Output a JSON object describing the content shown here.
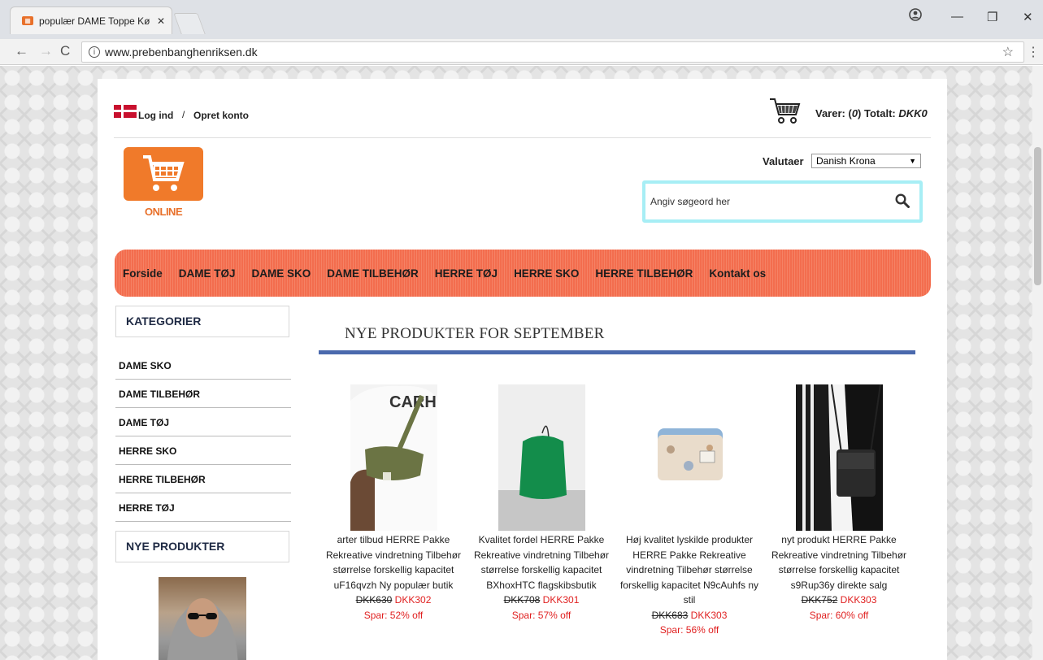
{
  "browser": {
    "tab_title": "populær DAME Toppe Kø",
    "url": "www.prebenbanghenriksen.dk"
  },
  "header": {
    "login": "Log ind",
    "separator": "/",
    "register": "Opret konto",
    "cart_prefix": "Varer: (",
    "cart_count": "0",
    "cart_mid": ") Totalt: ",
    "cart_total": "DKK0",
    "currency_label": "Valutaer",
    "currency_value": "Danish Krona",
    "search_placeholder": "Angiv søgeord her",
    "logo_text": "ONLINE"
  },
  "nav": [
    "Forside",
    "DAME TØJ",
    "DAME SKO",
    "DAME TILBEHØR",
    "HERRE TØJ",
    "HERRE SKO",
    "HERRE TILBEHØR",
    "Kontakt os"
  ],
  "sidebar": {
    "categories_title": "KATEGORIER",
    "categories": [
      "DAME SKO",
      "DAME TILBEHØR",
      "DAME TØJ",
      "HERRE SKO",
      "HERRE TILBEHØR",
      "HERRE TØJ"
    ],
    "new_products_title": "NYE PRODUKTER"
  },
  "main": {
    "title": "NYE PRODUKTER FOR SEPTEMBER",
    "products": [
      {
        "lines": [
          "arter tilbud HERRE Pakke",
          "Rekreative vindretning Tilbehør",
          "størrelse forskellig kapacitet",
          "uF16qvzh Ny populær butik"
        ],
        "old_price": "DKK630",
        "new_price": "DKK302",
        "save": "Spar: 52% off"
      },
      {
        "lines": [
          "Kvalitet fordel HERRE Pakke",
          "Rekreative vindretning Tilbehør",
          "størrelse forskellig kapacitet",
          "BXhoxHTC flagskibsbutik"
        ],
        "old_price": "DKK708",
        "new_price": "DKK301",
        "save": "Spar: 57% off"
      },
      {
        "lines": [
          "Høj kvalitet lyskilde produkter",
          "HERRE Pakke Rekreative",
          "vindretning Tilbehør størrelse",
          "forskellig kapacitet N9cAuhfs ny",
          "stil"
        ],
        "old_price": "DKK683",
        "new_price": "DKK303",
        "save": "Spar: 56% off"
      },
      {
        "lines": [
          "nyt produkt HERRE Pakke",
          "Rekreative vindretning Tilbehør",
          "størrelse forskellig kapacitet",
          "s9Rup36y direkte salg"
        ],
        "old_price": "DKK752",
        "new_price": "DKK303",
        "save": "Spar: 60% off"
      }
    ]
  },
  "colors": {
    "nav_bg": "#f36d4e",
    "accent_blue": "#4a69ad",
    "price_red": "#e01f1f",
    "search_border": "#a7eef5",
    "logo_orange": "#f07a2a"
  }
}
